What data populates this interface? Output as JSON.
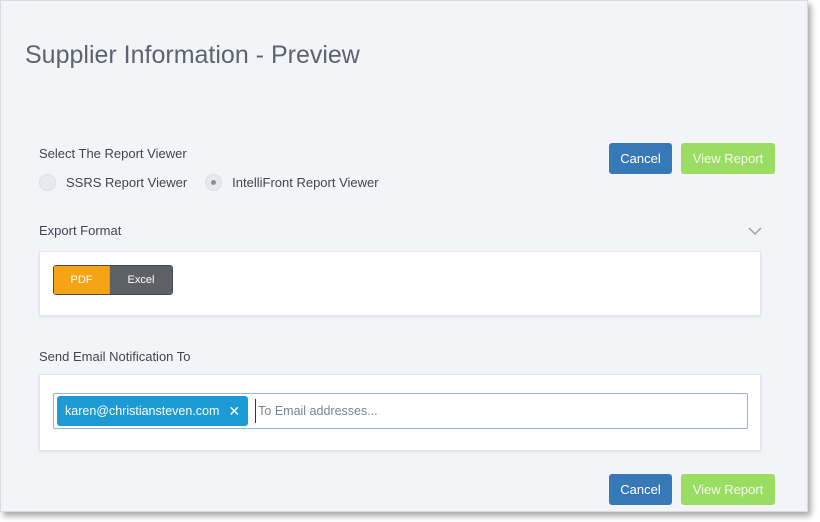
{
  "page": {
    "title": "Supplier Information - Preview"
  },
  "report_viewer": {
    "label": "Select The Report Viewer",
    "options": [
      {
        "label": "SSRS Report Viewer",
        "selected": false
      },
      {
        "label": "IntelliFront Report Viewer",
        "selected": true
      }
    ]
  },
  "actions": {
    "cancel_label": "Cancel",
    "view_label": "View Report"
  },
  "export": {
    "label": "Export Format",
    "formats": [
      {
        "label": "PDF",
        "active": true
      },
      {
        "label": "Excel",
        "active": false
      }
    ],
    "collapse_icon": "chevron-down-icon"
  },
  "email": {
    "label": "Send Email Notification To",
    "recipients": [
      {
        "address": "karen@christiansteven.com",
        "remove_icon": "close-icon"
      }
    ],
    "placeholder": "To Email addresses..."
  },
  "colors": {
    "primary": "#3779b7",
    "success": "#9bdc63",
    "accent": "#f7a316",
    "chip": "#1b9ad6",
    "dark": "#5d6066"
  }
}
